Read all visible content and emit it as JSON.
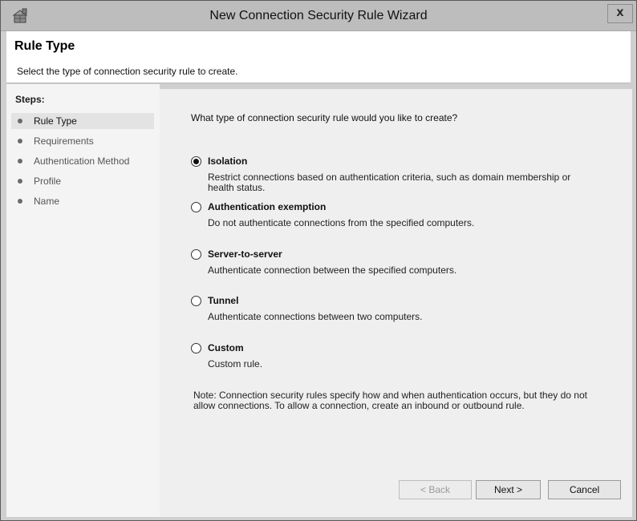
{
  "window": {
    "title": "New Connection Security Rule Wizard",
    "close_label": "x"
  },
  "header": {
    "title": "Rule Type",
    "subtitle": "Select the type of connection security rule to create."
  },
  "steps": {
    "heading": "Steps:",
    "items": [
      {
        "label": "Rule Type"
      },
      {
        "label": "Requirements"
      },
      {
        "label": "Authentication Method"
      },
      {
        "label": "Profile"
      },
      {
        "label": "Name"
      }
    ],
    "active_index": 0
  },
  "main": {
    "question": "What type of connection security rule would you like to create?",
    "options": [
      {
        "label": "Isolation",
        "description": "Restrict connections based on authentication criteria, such as domain membership or health status.",
        "checked": true
      },
      {
        "label": "Authentication exemption",
        "description": "Do not authenticate connections from the specified computers.",
        "checked": false
      },
      {
        "label": "Server-to-server",
        "description": "Authenticate connection between the specified computers.",
        "checked": false
      },
      {
        "label": "Tunnel",
        "description": "Authenticate connections between two computers.",
        "checked": false
      },
      {
        "label": "Custom",
        "description": "Custom rule.",
        "checked": false
      }
    ],
    "note": "Note:  Connection security rules specify how and when authentication occurs, but they do not allow connections.  To allow a connection, create an inbound or outbound rule."
  },
  "buttons": {
    "back": "< Back",
    "next": "Next >",
    "cancel": "Cancel"
  }
}
